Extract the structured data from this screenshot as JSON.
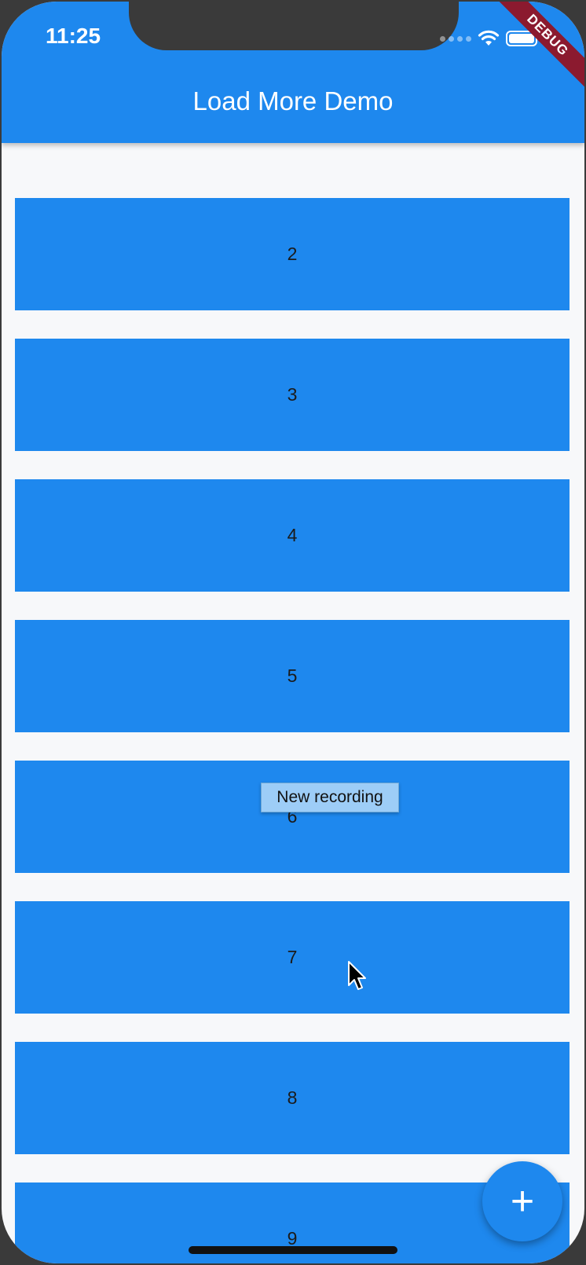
{
  "status_bar": {
    "time": "11:25"
  },
  "debug_banner": "DEBUG",
  "app_bar": {
    "title": "Load More Demo"
  },
  "list": {
    "items": [
      {
        "label": ""
      },
      {
        "label": "2"
      },
      {
        "label": "3"
      },
      {
        "label": "4"
      },
      {
        "label": "5"
      },
      {
        "label": "6"
      },
      {
        "label": "7"
      },
      {
        "label": "8"
      },
      {
        "label": "9"
      }
    ]
  },
  "tooltip": "New recording",
  "fab": {
    "icon": "plus-icon",
    "glyph": "+"
  },
  "colors": {
    "primary": "#1e88ee",
    "background": "#f7f8fa",
    "debug": "#8b1a2f"
  }
}
